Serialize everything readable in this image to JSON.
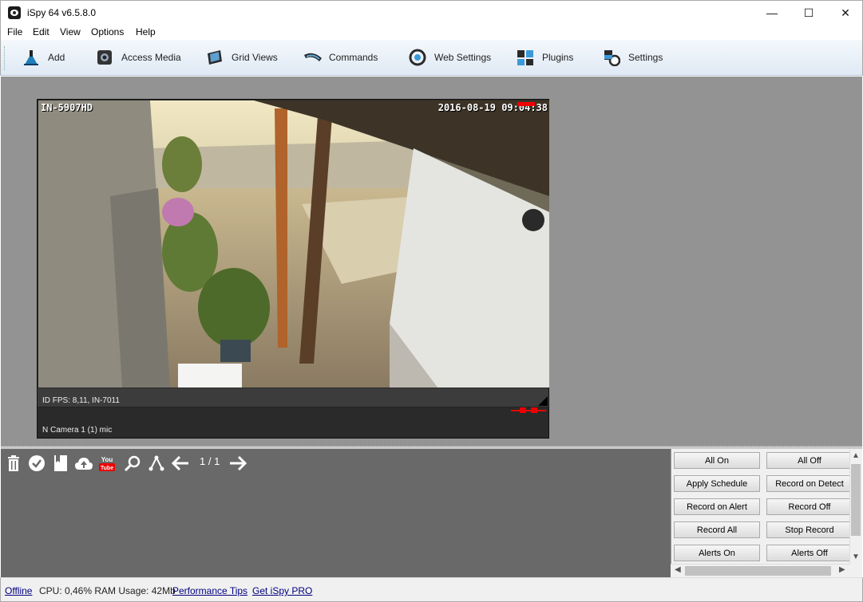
{
  "window": {
    "title": "iSpy 64 v6.5.8.0"
  },
  "menu": [
    "File",
    "Edit",
    "View",
    "Options",
    "Help"
  ],
  "toolbar": [
    {
      "label": "Add",
      "icon": "add-icon"
    },
    {
      "label": "Access Media",
      "icon": "media-icon"
    },
    {
      "label": "Grid Views",
      "icon": "grid-icon"
    },
    {
      "label": "Commands",
      "icon": "commands-icon"
    },
    {
      "label": "Web Settings",
      "icon": "web-icon"
    },
    {
      "label": "Plugins",
      "icon": "plugins-icon"
    },
    {
      "label": "Settings",
      "icon": "settings-icon"
    }
  ],
  "camera": {
    "overlay_label": "IN-5907HD",
    "overlay_time": "2016-08-19 09:04:38",
    "info": "ID  FPS: 8,11, IN-7011",
    "name": "N  Camera 1 (1) mic"
  },
  "media_panel": {
    "page": "1 / 1"
  },
  "commands": [
    "All On",
    "All Off",
    "Apply Schedule",
    "Record on Detect",
    "Record on Alert",
    "Record Off",
    "Record All",
    "Stop Record",
    "Alerts On",
    "Alerts Off"
  ],
  "status": {
    "offline": "Offline",
    "usage": "CPU: 0,46% RAM Usage: 42Mb",
    "tips": "Performance Tips",
    "pro": "Get iSpy PRO"
  }
}
